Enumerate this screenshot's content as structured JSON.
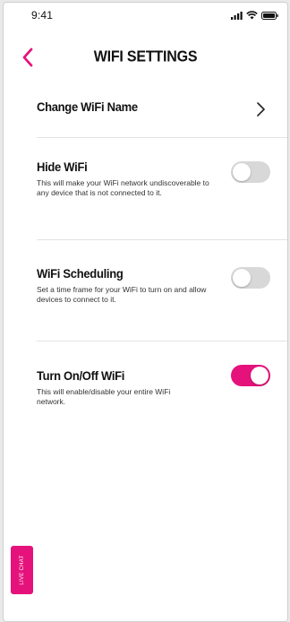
{
  "status_bar": {
    "time": "9:41"
  },
  "header": {
    "title": "WIFI SETTINGS"
  },
  "settings": {
    "change_name": {
      "title": "Change WiFi Name"
    },
    "hide_wifi": {
      "title": "Hide WiFi",
      "description": "This will make your WiFi network undiscoverable to any device that is not connected to it.",
      "enabled": false
    },
    "scheduling": {
      "title": "WiFi Scheduling",
      "description": "Set a time frame for your WiFi to turn on and allow devices to connect to it.",
      "enabled": false
    },
    "turn_on_off": {
      "title": "Turn On/Off WiFi",
      "description": "This will enable/disable your entire WiFi network.",
      "enabled": true
    }
  },
  "live_chat": {
    "label": "LIVE CHAT"
  },
  "colors": {
    "accent": "#e5127c",
    "toggle_off": "#d8d8d8"
  },
  "icons": [
    "cellular-signal-icon",
    "wifi-icon",
    "battery-icon",
    "back-chevron-icon",
    "chevron-right-icon"
  ]
}
